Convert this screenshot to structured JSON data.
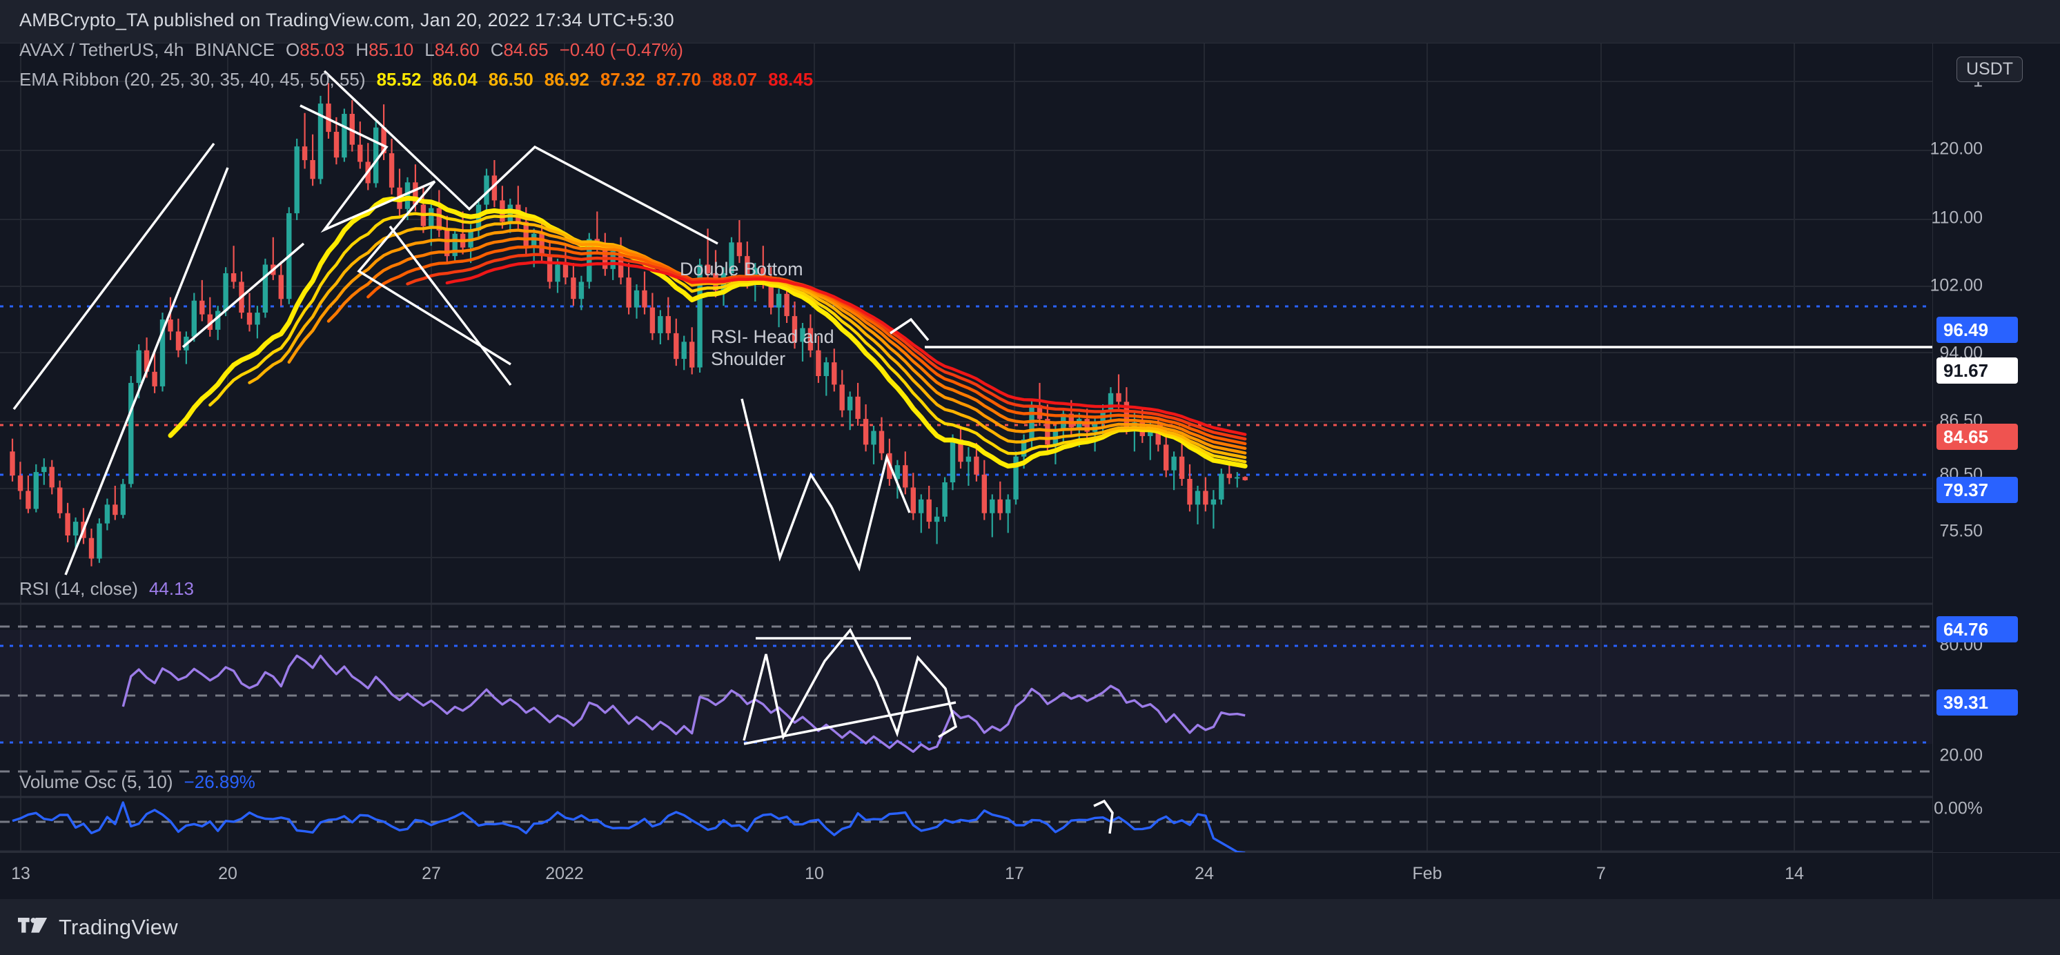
{
  "attribution": "AMBCrypto_TA published on TradingView.com, Jan 20, 2022 17:34 UTC+5:30",
  "footer": {
    "brand": "TradingView"
  },
  "symbol_legend": {
    "symbol": "AVAX / TetherUS",
    "interval": "4h",
    "exchange": "BINANCE",
    "o_label": "O",
    "o_value": "85.03",
    "h_label": "H",
    "h_value": "85.10",
    "l_label": "L",
    "l_value": "84.60",
    "c_label": "C",
    "c_value": "84.65",
    "change": "−0.40 (−0.47%)"
  },
  "ema_legend": {
    "title": "EMA Ribbon (20, 25, 30, 35, 40, 45, 50, 55)",
    "values": [
      "85.52",
      "86.04",
      "86.50",
      "86.92",
      "87.32",
      "87.70",
      "88.07",
      "88.45"
    ],
    "colors": [
      "#ffeb00",
      "#ffd400",
      "#ffb300",
      "#ff9800",
      "#ff7a00",
      "#fa5e00",
      "#f23b10",
      "#f01717"
    ]
  },
  "rsi_legend": {
    "title": "RSI (14, close)",
    "value": "44.13"
  },
  "volume_legend": {
    "title": "Volume Osc (5, 10)",
    "value": "−26.89%"
  },
  "price_axis": {
    "unit_chip": "USDT",
    "labels": [
      "1",
      "120.00",
      "110.00",
      "102.00",
      "94.00",
      "86.50",
      "80.50",
      "75.50"
    ],
    "badges": [
      {
        "name": "resistance-level-badge",
        "text": "96.49",
        "style": "blue"
      },
      {
        "name": "drawn-level-badge",
        "text": "91.67",
        "style": "white"
      },
      {
        "name": "last-price-badge",
        "text": "84.65",
        "style": "red"
      },
      {
        "name": "support-level-badge",
        "text": "79.37",
        "style": "blue"
      }
    ]
  },
  "rsi_axis": {
    "labels": [
      "80.00",
      "20.00"
    ],
    "badges": [
      {
        "name": "rsi-upper-band-badge",
        "text": "64.76",
        "style": "blue"
      },
      {
        "name": "rsi-lower-band-badge",
        "text": "39.31",
        "style": "blue"
      }
    ]
  },
  "volume_axis": {
    "labels": [
      "0.00%"
    ]
  },
  "time_axis": {
    "labels": [
      "13",
      "20",
      "27",
      "2022",
      "10",
      "17",
      "24",
      "Feb",
      "7",
      "14"
    ]
  },
  "annotations": [
    {
      "name": "double-bottom-annotation",
      "text": "Double Bottom"
    },
    {
      "name": "rsi-head-and-shoulder-annotation",
      "text": "RSI- Head and\nShoulder"
    }
  ],
  "colors": {
    "background": "#1e222d",
    "pane": "#131722",
    "grid": "#242832",
    "up_candle": "#26a69a",
    "down_candle": "#ef5350",
    "rsi_line": "#9c7ce8",
    "volume_line": "#2962ff",
    "drawing": "#ffffff",
    "blue_badge": "#2962ff",
    "red_badge": "#ef5350"
  },
  "chart_data": {
    "type": "line",
    "title": "AVAX / TetherUS 4h — BINANCE",
    "xlabel": "",
    "ylabel": "USDT",
    "ylim": [
      72.0,
      134.0
    ],
    "grid": true,
    "legend": "top-left",
    "x_tick_labels": [
      "13",
      "20",
      "27",
      "2022",
      "10",
      "17",
      "24",
      "Feb",
      "7",
      "14"
    ],
    "y_tick_labels": [
      "120.00",
      "110.00",
      "102.00",
      "94.00",
      "86.50",
      "80.50",
      "75.50"
    ],
    "horizontal_levels": [
      {
        "label": "96.49",
        "value": 96.49,
        "style": "blue dotted"
      },
      {
        "label": "91.67",
        "value": 91.67,
        "style": "white solid"
      },
      {
        "label": "84.65",
        "value": 84.65,
        "style": "red dotted"
      },
      {
        "label": "79.37",
        "value": 79.37,
        "style": "blue dotted"
      }
    ],
    "ohlc_last": {
      "open": 85.03,
      "high": 85.1,
      "low": 84.6,
      "close": 84.65,
      "change": -0.4,
      "change_pct": -0.47
    },
    "candles": [
      [
        88.0,
        89.5,
        84.5,
        85.2
      ],
      [
        85.2,
        86.8,
        82.4,
        83.4
      ],
      [
        83.4,
        85.2,
        80.8,
        81.3
      ],
      [
        81.3,
        86.5,
        80.9,
        85.6
      ],
      [
        85.6,
        87.2,
        84.1,
        86.2
      ],
      [
        86.2,
        87.0,
        83.0,
        83.8
      ],
      [
        83.8,
        84.6,
        80.2,
        80.8
      ],
      [
        80.8,
        82.0,
        77.4,
        78.2
      ],
      [
        78.2,
        80.3,
        76.5,
        79.8
      ],
      [
        79.8,
        81.4,
        77.2,
        77.9
      ],
      [
        77.9,
        79.0,
        74.6,
        75.5
      ],
      [
        75.5,
        80.2,
        75.0,
        79.6
      ],
      [
        79.6,
        82.5,
        78.8,
        81.8
      ],
      [
        81.8,
        84.0,
        80.0,
        80.6
      ],
      [
        80.6,
        84.8,
        80.2,
        84.2
      ],
      [
        84.2,
        96.8,
        83.8,
        96.0
      ],
      [
        96.0,
        100.5,
        94.2,
        99.8
      ],
      [
        99.8,
        101.3,
        96.6,
        97.3
      ],
      [
        97.3,
        99.5,
        94.8,
        95.6
      ],
      [
        95.6,
        104.2,
        95.0,
        103.4
      ],
      [
        103.4,
        106.0,
        101.0,
        102.0
      ],
      [
        102.0,
        103.5,
        99.0,
        99.8
      ],
      [
        99.8,
        102.0,
        98.2,
        101.4
      ],
      [
        101.4,
        106.5,
        100.8,
        105.6
      ],
      [
        105.6,
        108.0,
        103.2,
        104.0
      ],
      [
        104.0,
        106.0,
        101.4,
        102.2
      ],
      [
        102.2,
        105.0,
        101.0,
        104.4
      ],
      [
        104.4,
        109.5,
        103.8,
        108.8
      ],
      [
        108.8,
        112.0,
        107.0,
        107.8
      ],
      [
        107.8,
        109.0,
        103.5,
        104.2
      ],
      [
        104.2,
        106.5,
        102.0,
        102.8
      ],
      [
        102.8,
        105.0,
        101.2,
        104.2
      ],
      [
        104.2,
        110.5,
        103.6,
        109.8
      ],
      [
        109.8,
        113.0,
        108.0,
        108.6
      ],
      [
        108.6,
        110.2,
        105.0,
        105.8
      ],
      [
        105.8,
        116.5,
        105.2,
        115.8
      ],
      [
        115.8,
        124.5,
        115.0,
        123.6
      ],
      [
        123.6,
        127.5,
        121.0,
        122.0
      ],
      [
        122.0,
        125.0,
        119.0,
        119.8
      ],
      [
        119.8,
        129.5,
        119.2,
        128.6
      ],
      [
        128.6,
        131.0,
        124.5,
        125.3
      ],
      [
        125.3,
        127.0,
        121.5,
        122.3
      ],
      [
        122.3,
        128.0,
        121.8,
        127.4
      ],
      [
        127.4,
        129.0,
        123.0,
        123.8
      ],
      [
        123.8,
        126.5,
        121.0,
        121.8
      ],
      [
        121.8,
        124.0,
        118.5,
        119.3
      ],
      [
        119.3,
        126.5,
        118.8,
        125.8
      ],
      [
        125.8,
        128.5,
        122.0,
        122.8
      ],
      [
        122.8,
        124.5,
        118.0,
        118.8
      ],
      [
        118.8,
        121.0,
        115.5,
        116.3
      ],
      [
        116.3,
        120.0,
        115.0,
        119.4
      ],
      [
        119.4,
        121.5,
        116.0,
        116.8
      ],
      [
        116.8,
        119.0,
        113.5,
        114.3
      ],
      [
        114.3,
        117.0,
        112.0,
        116.4
      ],
      [
        116.4,
        118.5,
        113.0,
        113.8
      ],
      [
        113.8,
        115.5,
        110.0,
        110.8
      ],
      [
        110.8,
        114.0,
        110.2,
        113.4
      ],
      [
        113.4,
        116.0,
        111.0,
        111.8
      ],
      [
        111.8,
        114.5,
        110.0,
        113.8
      ],
      [
        113.8,
        117.5,
        113.0,
        116.8
      ],
      [
        116.8,
        121.0,
        116.0,
        120.2
      ],
      [
        120.2,
        122.0,
        116.5,
        117.3
      ],
      [
        117.3,
        119.0,
        114.0,
        114.8
      ],
      [
        114.8,
        117.5,
        113.5,
        116.8
      ],
      [
        116.8,
        119.0,
        114.0,
        114.8
      ],
      [
        114.8,
        116.5,
        111.0,
        111.8
      ],
      [
        111.8,
        114.0,
        109.5,
        113.4
      ],
      [
        113.4,
        115.0,
        110.0,
        110.8
      ],
      [
        110.8,
        112.5,
        107.0,
        107.8
      ],
      [
        107.8,
        110.5,
        106.5,
        109.8
      ],
      [
        109.8,
        112.0,
        107.5,
        108.3
      ],
      [
        108.3,
        110.0,
        105.0,
        105.8
      ],
      [
        105.8,
        108.5,
        104.5,
        107.8
      ],
      [
        107.8,
        113.5,
        107.0,
        112.8
      ],
      [
        112.8,
        116.0,
        111.0,
        111.8
      ],
      [
        111.8,
        113.5,
        108.5,
        109.3
      ],
      [
        109.3,
        112.0,
        108.0,
        111.4
      ],
      [
        111.4,
        113.0,
        107.5,
        108.3
      ],
      [
        108.3,
        110.0,
        104.0,
        104.8
      ],
      [
        104.8,
        107.5,
        103.5,
        106.8
      ],
      [
        106.8,
        109.0,
        104.0,
        104.8
      ],
      [
        104.8,
        106.5,
        101.0,
        101.8
      ],
      [
        101.8,
        104.5,
        100.5,
        103.8
      ],
      [
        103.8,
        106.0,
        101.0,
        101.8
      ],
      [
        101.8,
        103.5,
        98.0,
        98.8
      ],
      [
        98.8,
        101.5,
        97.5,
        100.8
      ],
      [
        100.8,
        102.5,
        97.0,
        97.8
      ],
      [
        97.8,
        110.5,
        97.2,
        109.8
      ],
      [
        109.8,
        114.0,
        108.0,
        108.8
      ],
      [
        108.8,
        111.5,
        106.0,
        106.8
      ],
      [
        106.8,
        109.5,
        105.0,
        108.8
      ],
      [
        108.8,
        113.0,
        107.5,
        112.4
      ],
      [
        112.4,
        115.0,
        110.0,
        110.8
      ],
      [
        110.8,
        112.5,
        107.0,
        107.8
      ],
      [
        107.8,
        110.0,
        105.5,
        109.4
      ],
      [
        109.4,
        112.0,
        107.0,
        107.8
      ],
      [
        107.8,
        109.5,
        104.0,
        104.8
      ],
      [
        104.8,
        107.0,
        102.5,
        106.4
      ],
      [
        106.4,
        108.0,
        103.0,
        103.8
      ],
      [
        103.8,
        105.5,
        100.0,
        100.8
      ],
      [
        100.8,
        103.0,
        98.5,
        102.4
      ],
      [
        102.4,
        104.0,
        99.0,
        99.8
      ],
      [
        99.8,
        101.5,
        96.0,
        96.8
      ],
      [
        96.8,
        99.0,
        94.5,
        98.4
      ],
      [
        98.4,
        100.0,
        95.0,
        95.8
      ],
      [
        95.8,
        97.5,
        92.0,
        92.8
      ],
      [
        92.8,
        95.0,
        90.5,
        94.4
      ],
      [
        94.4,
        96.0,
        91.0,
        91.8
      ],
      [
        91.8,
        93.5,
        88.0,
        88.8
      ],
      [
        88.8,
        91.0,
        86.5,
        90.4
      ],
      [
        90.4,
        92.0,
        87.0,
        87.8
      ],
      [
        87.8,
        89.5,
        84.0,
        84.8
      ],
      [
        84.8,
        87.0,
        82.5,
        86.4
      ],
      [
        86.4,
        88.0,
        83.0,
        83.8
      ],
      [
        83.8,
        85.5,
        80.0,
        80.8
      ],
      [
        80.8,
        83.0,
        78.5,
        82.4
      ],
      [
        82.4,
        84.0,
        79.0,
        79.8
      ],
      [
        79.8,
        81.5,
        77.2,
        80.4
      ],
      [
        80.4,
        85.0,
        79.8,
        84.4
      ],
      [
        84.4,
        90.0,
        83.5,
        89.4
      ],
      [
        89.4,
        91.0,
        86.0,
        86.8
      ],
      [
        86.8,
        88.5,
        84.0,
        87.4
      ],
      [
        87.4,
        89.0,
        84.5,
        85.3
      ],
      [
        85.3,
        87.0,
        80.0,
        80.8
      ],
      [
        80.8,
        83.0,
        78.0,
        82.4
      ],
      [
        82.4,
        84.5,
        80.0,
        80.8
      ],
      [
        80.8,
        83.0,
        78.5,
        82.4
      ],
      [
        82.4,
        88.0,
        81.8,
        87.4
      ],
      [
        87.4,
        90.0,
        86.0,
        89.4
      ],
      [
        89.4,
        94.0,
        88.5,
        93.4
      ],
      [
        93.4,
        96.0,
        91.0,
        91.8
      ],
      [
        91.8,
        93.5,
        88.0,
        88.8
      ],
      [
        88.8,
        91.0,
        86.5,
        90.4
      ],
      [
        90.4,
        93.0,
        89.0,
        92.4
      ],
      [
        92.4,
        94.0,
        90.0,
        90.8
      ],
      [
        90.8,
        92.5,
        88.5,
        91.8
      ],
      [
        91.8,
        93.0,
        89.5,
        90.3
      ],
      [
        90.3,
        92.0,
        88.0,
        91.4
      ],
      [
        91.4,
        93.5,
        90.0,
        92.8
      ],
      [
        92.8,
        95.5,
        91.5,
        94.8
      ],
      [
        94.8,
        97.0,
        93.0,
        93.8
      ],
      [
        93.8,
        95.5,
        90.0,
        90.8
      ],
      [
        90.8,
        92.5,
        88.0,
        91.4
      ],
      [
        91.4,
        93.0,
        89.0,
        89.8
      ],
      [
        89.8,
        91.5,
        87.0,
        90.4
      ],
      [
        90.4,
        92.0,
        88.0,
        88.8
      ],
      [
        88.8,
        90.5,
        85.0,
        85.8
      ],
      [
        85.8,
        88.0,
        83.5,
        87.4
      ],
      [
        87.4,
        89.0,
        84.0,
        84.8
      ],
      [
        84.8,
        86.5,
        81.0,
        81.8
      ],
      [
        81.8,
        84.0,
        79.5,
        83.4
      ],
      [
        83.4,
        85.0,
        81.0,
        81.8
      ],
      [
        81.8,
        83.5,
        79.0,
        82.4
      ],
      [
        82.4,
        86.0,
        81.8,
        85.4
      ],
      [
        85.4,
        86.5,
        84.2,
        84.9
      ],
      [
        84.9,
        85.6,
        83.8,
        85.0
      ],
      [
        85.03,
        85.1,
        84.6,
        84.65
      ]
    ],
    "ema_ribbon": {
      "periods": [
        20,
        25,
        30,
        35,
        40,
        45,
        50,
        55
      ],
      "last_values": [
        85.52,
        86.04,
        86.5,
        86.92,
        87.32,
        87.7,
        88.07,
        88.45
      ],
      "colors": [
        "#ffeb00",
        "#ffd400",
        "#ffb300",
        "#ff9800",
        "#ff7a00",
        "#fa5e00",
        "#f23b10",
        "#f01717"
      ]
    },
    "panes": [
      {
        "name": "RSI (14, close)",
        "current": 44.13,
        "levels": [
          80.0,
          64.76,
          39.31,
          20.0
        ],
        "range": [
          12,
          88
        ],
        "color": "#9c7ce8",
        "annotation": "RSI- Head and Shoulder"
      },
      {
        "name": "Volume Osc (5, 10)",
        "current": -26.89,
        "levels": [
          0.0
        ],
        "color": "#2962ff"
      }
    ]
  }
}
